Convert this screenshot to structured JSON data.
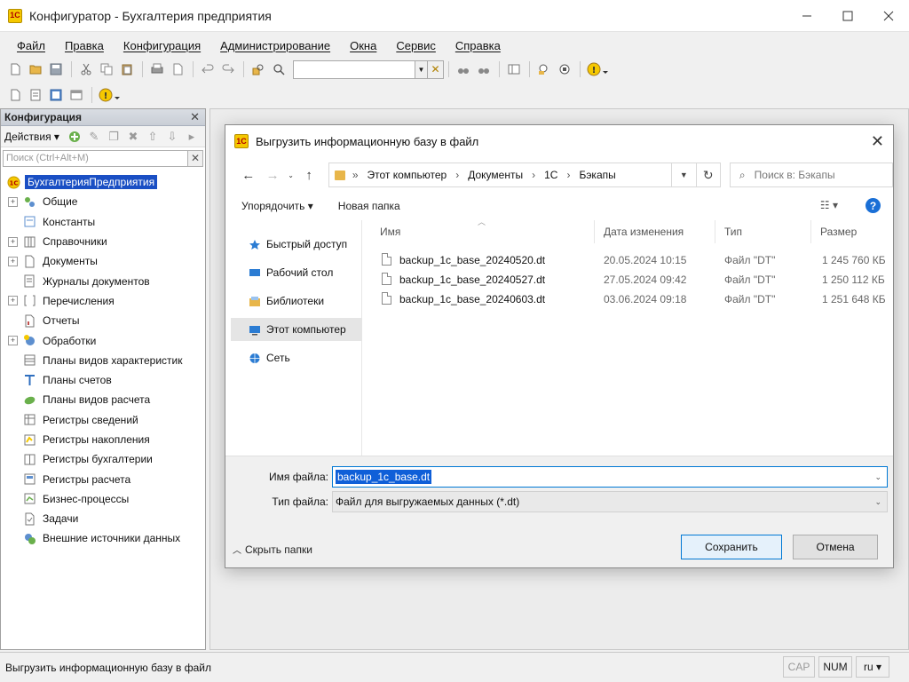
{
  "window": {
    "title": "Конфигуратор - Бухгалтерия предприятия",
    "icon_text": "1С",
    "controls": [
      "minimize",
      "maximize",
      "close"
    ]
  },
  "menu": {
    "items": [
      "Файл",
      "Правка",
      "Конфигурация",
      "Администрирование",
      "Окна",
      "Сервис",
      "Справка"
    ]
  },
  "toolbar": {
    "search_value": ""
  },
  "config_panel": {
    "title": "Конфигурация",
    "actions_label": "Действия",
    "search_placeholder": "Поиск (Ctrl+Alt+M)",
    "root": "БухгалтерияПредприятия",
    "items": [
      {
        "label": "Общие",
        "expandable": true,
        "icon": "common-icon"
      },
      {
        "label": "Константы",
        "expandable": false,
        "icon": "constants-icon"
      },
      {
        "label": "Справочники",
        "expandable": true,
        "icon": "catalogs-icon"
      },
      {
        "label": "Документы",
        "expandable": true,
        "icon": "documents-icon"
      },
      {
        "label": "Журналы документов",
        "expandable": false,
        "icon": "journals-icon"
      },
      {
        "label": "Перечисления",
        "expandable": true,
        "icon": "enums-icon"
      },
      {
        "label": "Отчеты",
        "expandable": false,
        "icon": "reports-icon"
      },
      {
        "label": "Обработки",
        "expandable": true,
        "icon": "processing-icon"
      },
      {
        "label": "Планы видов характеристик",
        "expandable": false,
        "icon": "chart-of-char-icon"
      },
      {
        "label": "Планы счетов",
        "expandable": false,
        "icon": "chart-of-accounts-icon"
      },
      {
        "label": "Планы видов расчета",
        "expandable": false,
        "icon": "calc-types-icon"
      },
      {
        "label": "Регистры сведений",
        "expandable": false,
        "icon": "info-registers-icon"
      },
      {
        "label": "Регистры накопления",
        "expandable": false,
        "icon": "accum-registers-icon"
      },
      {
        "label": "Регистры бухгалтерии",
        "expandable": false,
        "icon": "acc-registers-icon"
      },
      {
        "label": "Регистры расчета",
        "expandable": false,
        "icon": "calc-registers-icon"
      },
      {
        "label": "Бизнес-процессы",
        "expandable": false,
        "icon": "business-process-icon"
      },
      {
        "label": "Задачи",
        "expandable": false,
        "icon": "tasks-icon"
      },
      {
        "label": "Внешние источники данных",
        "expandable": false,
        "icon": "external-sources-icon"
      }
    ]
  },
  "dialog": {
    "title": "Выгрузить информационную базу в файл",
    "breadcrumb": [
      "Этот компьютер",
      "Документы",
      "1С",
      "Бэкапы"
    ],
    "breadcrumb_prefix": "»",
    "search_placeholder": "Поиск в: Бэкапы",
    "organize_label": "Упорядочить",
    "new_folder_label": "Новая папка",
    "nav_items": [
      {
        "label": "Быстрый доступ",
        "icon": "quick-access-icon"
      },
      {
        "label": "Рабочий стол",
        "icon": "desktop-icon"
      },
      {
        "label": "Библиотеки",
        "icon": "libraries-icon"
      },
      {
        "label": "Этот компьютер",
        "icon": "this-pc-icon",
        "selected": true
      },
      {
        "label": "Сеть",
        "icon": "network-icon"
      }
    ],
    "columns": [
      "Имя",
      "Дата изменения",
      "Тип",
      "Размер"
    ],
    "files": [
      {
        "name": "backup_1c_base_20240520.dt",
        "date": "20.05.2024 10:15",
        "type": "Файл \"DT\"",
        "size": "1 245 760 КБ"
      },
      {
        "name": "backup_1c_base_20240527.dt",
        "date": "27.05.2024 09:42",
        "type": "Файл \"DT\"",
        "size": "1 250 112 КБ"
      },
      {
        "name": "backup_1c_base_20240603.dt",
        "date": "03.06.2024 09:18",
        "type": "Файл \"DT\"",
        "size": "1 251 648 КБ"
      }
    ],
    "filename_label": "Имя файла:",
    "filename_value": "backup_1c_base.dt",
    "filetype_label": "Тип файла:",
    "filetype_value": "Файл для выгружаемых данных (*.dt)",
    "hide_folders_label": "Скрыть папки",
    "save_label": "Сохранить",
    "cancel_label": "Отмена"
  },
  "status": {
    "text": "Выгрузить информационную базу в файл",
    "caps": "CAP",
    "num": "NUM",
    "lang": "ru"
  },
  "colors": {
    "selection": "#1a4fc4",
    "accent": "#0078d4",
    "brand_yellow": "#f5c800"
  }
}
